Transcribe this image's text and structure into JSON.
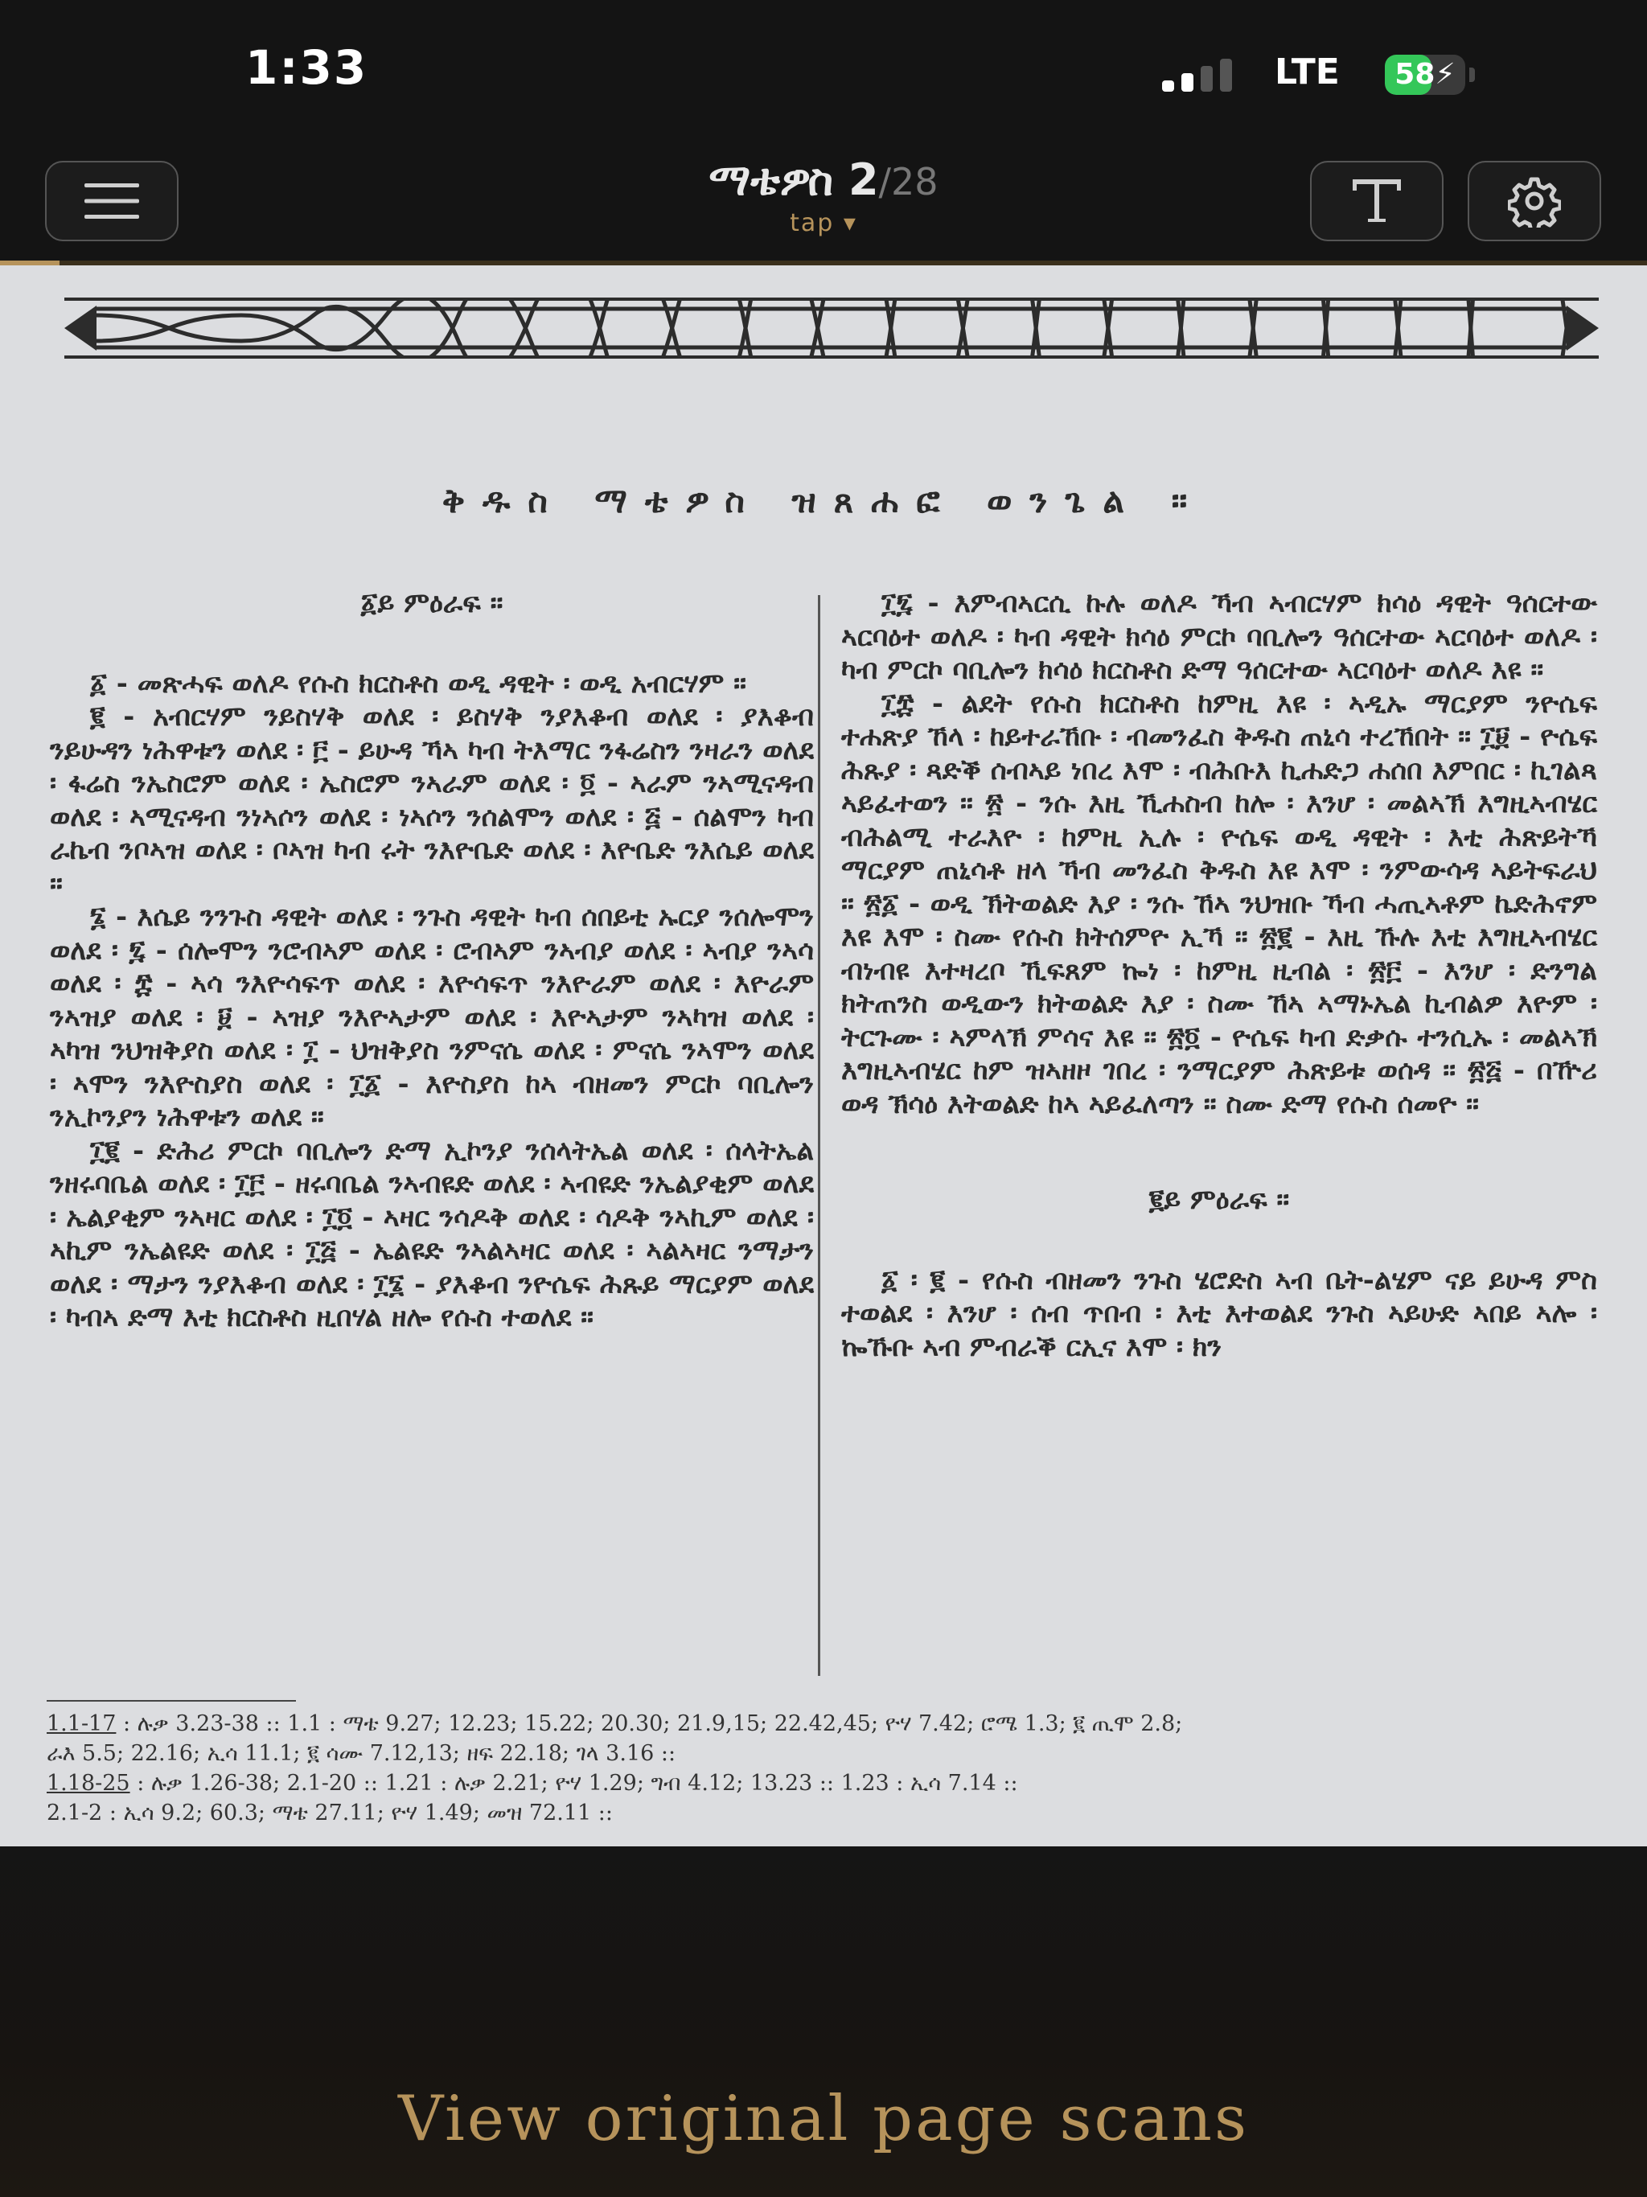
{
  "status": {
    "time": "1:33",
    "network": "LTE",
    "battery": "58",
    "battery_level": 0.58,
    "signal_bars_filled": 2,
    "signal_bars_total": 4
  },
  "header": {
    "book": "ማቴዎስ",
    "page_current": "2",
    "page_total": "/28",
    "mode": "tap ▾",
    "progress": 0.036,
    "icons": {
      "menu": "hamburger-menu-icon",
      "text": "text-size-icon",
      "settings": "gear-icon"
    }
  },
  "scan": {
    "title": "ቅዱስ ማቴዎስ ዝጸሐፎ ወንጌል ።",
    "left_column": [
      {
        "type": "head",
        "text": "፩ይ ምዕራፍ ።"
      },
      {
        "type": "para",
        "text": "፩ - መጽሓፍ ወለዶ የሱስ ክርስቶስ ወዲ ዳዊት ፡ ወዲ አብርሃም ።"
      },
      {
        "type": "para",
        "text": "፪ - አብርሃም ንይስሃቅ ወለደ ፡ ይስሃቅ ንያእቆብ ወለደ ፡ ያእቆብ ንይሁዳን ነሕዋቱን ወለደ ፡ ፫ - ይሁዳ ኻኣ ካብ ትእማር ንፋሬስን ንዛራን ወለደ ፡ ፋሬስ ንኤስሮም ወለደ ፡ ኤስሮም ንኣራም ወለደ ፡ ፬ - ኣራም ንኣሚናዳብ ወለደ ፡ ኣሚናዳብ ንነኣሶን ወለደ ፡ ነኣሶን ንሰልሞን ወለደ ፡ ፭ - ሰልሞን ካብ ራኬብ ንቦኣዝ ወለደ ፡ ቦኣዝ ካብ ሩት ንእዮቤድ ወለደ ፡ እዮቤድ ንእሴይ ወለደ ።"
      },
      {
        "type": "para",
        "text": "፮ - እሴይ ንንጉስ ዳዊት ወለደ ፡ ንጉስ ዳዊት ካብ ሰበይቲ ኡርያ ንሰሎሞን ወለደ ፡ ፯ - ሰሎሞን ንሮብኣም ወለደ ፡ ሮብኣም ንኣብያ ወለደ ፡ ኣብያ ንኣሳ ወለደ ፡ ፰ - ኣሳ ንእዮሳፍጥ ወለደ ፡ እዮሳፍጥ ንእዮራም ወለደ ፡ እዮራም ንኣዝያ ወለደ ፡ ፱ - ኣዝያ ንእዮኣታም ወለደ ፡ እዮኣታም ንኣካዝ ወለደ ፡ ኣካዝ ንህዝቅያስ ወለደ ፡ ፲ - ህዝቅያስ ንምናሴ ወለደ ፡ ምናሴ ንኣሞን ወለደ ፡ ኣሞን ንእዮስያስ ወለደ ፡ ፲፩ - እዮስያስ ከኣ ብዘመን ምርኮ ባቢሎን ንኢኮንያን ነሕዋቱን ወለደ ።"
      },
      {
        "type": "para",
        "text": "፲፪ - ድሕሪ ምርኮ ባቢሎን ድማ ኢኮንያ ንሰላትኤል ወለደ ፡ ሰላትኤል ንዘሩባቤል ወለደ ፡ ፲፫ - ዘሩባቤል ንኣብዩድ ወለደ ፡ ኣብዩድ ንኤልያቂም ወለደ ፡ ኤልያቂም ንኣዛር ወለደ ፡ ፲፬ - ኣዛር ንሳዶቅ ወለደ ፡ ሳዶቅ ንኣኪም ወለደ ፡ ኣኪም ንኤልዩድ ወለደ ፡ ፲፭ - ኤልዩድ ንኣልኣዛር ወለደ ፡ ኣልኣዛር ንማታን ወለደ ፡ ማታን ንያእቆብ ወለደ ፡ ፲፮ - ያእቆብ ንዮሴፍ ሕጹይ ማርያም ወለደ ፡ ካብኣ ድማ እቲ ክርስቶስ ዚበሃል ዘሎ የሱስ ተወለደ ።"
      }
    ],
    "right_column": [
      {
        "type": "para",
        "text": "፲፯ - እምብኣርሲ ኩሉ ወለዶ ኻብ ኣብርሃም ክሳዕ ዳዊት ዓሰርተው ኣርባዕተ ወለዶ ፡ ካብ ዳዊት ክሳዕ ምርኮ ባቢሎን ዓሰርተው ኣርባዕተ ወለዶ ፡ ካብ ምርኮ ባቢሎን ክሳዕ ክርስቶስ ድማ ዓሰርተው ኣርባዕተ ወለዶ እዩ ።"
      },
      {
        "type": "para",
        "text": "፲፰ - ልደት የሱስ ክርስቶስ ከምዚ እዩ ፡ ኣዲኡ ማርያም ንዮሴፍ ተሐጽያ ኸላ ፡ ከይተራኸቡ ፡ ብመንፈስ ቅዱስ ጠኒሳ ተረኸበት ። ፲፱ - ዮሴፍ ሕጹያ ፡ ጻድቕ ሰብኣይ ነበረ እሞ ፡ ብሕቡእ ኪሐድጋ ሐሰበ እምበር ፡ ኪገልጻ ኣይፈተወን ። ፳ - ንሱ እዚ ኺሐስብ ከሎ ፡ እንሆ ፡ መልኣኽ እግዚኣብሄር ብሕልሚ ተራእዮ ፡ ከምዚ ኢሉ ፡ ዮሴፍ ወዲ ዳዊት ፡ እቲ ሕጽይትኻ ማርያም ጠኒሳቶ ዘላ ኻብ መንፈስ ቅዱስ እዩ እሞ ፡ ንምውሳዳ ኣይትፍራህ ። ፳፩ - ወዲ ኽትወልድ እያ ፡ ንሱ ኸኣ ንህዝቡ ኻብ ሓጢኣቶም ኬድሕኖም እዩ እሞ ፡ ስሙ የሱስ ክትሰምዮ ኢኻ ። ፳፪ - እዚ ኹሉ እቲ እግዚኣብሄር ብነብዩ እተዛረቦ ኺፍጸም ኰነ ፡ ከምዚ ዚብል ፡ ፳፫ - እንሆ ፡ ድንግል ክትጠንስ ወዲውን ክትወልድ እያ ፡ ስሙ ኸኣ ኣማኑኤል ኪብልዎ እዮም ፡ ትርጉሙ ፡ ኣምላኽ ምሳና እዩ ። ፳፬ - ዮሴፍ ካብ ድቃሱ ተንሲኡ ፡ መልኣኽ እግዚኣብሄር ከም ዝኣዘዞ ገበረ ፡ ንማርያም ሕጽይቱ ወሰዳ ። ፳፭ - በዅሪ ወዳ ኽሳዕ እትወልድ ከኣ ኣይፈለጣን ። ስሙ ድማ የሱስ ሰመዮ ።"
      },
      {
        "type": "head_r",
        "text": "፪ይ ምዕራፍ ።"
      },
      {
        "type": "para",
        "text": "፩ ፡ ፪ - የሱስ ብዘመን ንጉስ ሄሮድስ ኣብ ቤት-ልሄም ናይ ይሁዳ ምስ ተወልደ ፡ እንሆ ፡ ሰብ ጥበብ ፡ እቲ እተወልደ ንጉስ ኣይሁድ ኣበይ ኣሎ ፡ ኰኹቡ ኣብ ምብራቕ ርኢና እሞ ፡ ክን"
      }
    ],
    "footnotes": [
      {
        "ref": "1.1-17",
        "text": " : ሉቃ 3.23-38 :: 1.1 : ማቴ 9.27; 12.23; 15.22; 20.30; 21.9,15; 22.42,45; ዮሃ 7.42; ሮሜ 1.3; ፪ ጢሞ 2.8;"
      },
      {
        "ref": "",
        "text": "ራእ 5.5; 22.16; ኢሳ 11.1; ፪ ሳሙ 7.12,13; ዘፍ 22.18; ገላ 3.16 ::"
      },
      {
        "ref": "1.18-25",
        "text": " : ሉቃ 1.26-38; 2.1-20 :: 1.21 : ሉቃ 2.21; ዮሃ 1.29; ግብ 4.12; 13.23 :: 1.23 : ኢሳ 7.14 ::"
      },
      {
        "ref": "",
        "text": "2.1-2 : ኢሳ 9.2; 60.3; ማቴ 27.11; ዮሃ 1.49; መዝ 72.11 ::"
      }
    ]
  },
  "footer": {
    "view_scans_label": "View original page scans"
  },
  "colors": {
    "accent_gold": "#b6935b",
    "background": "#141414",
    "scan_paper": "#dcdde0",
    "battery_green": "#34c759"
  }
}
